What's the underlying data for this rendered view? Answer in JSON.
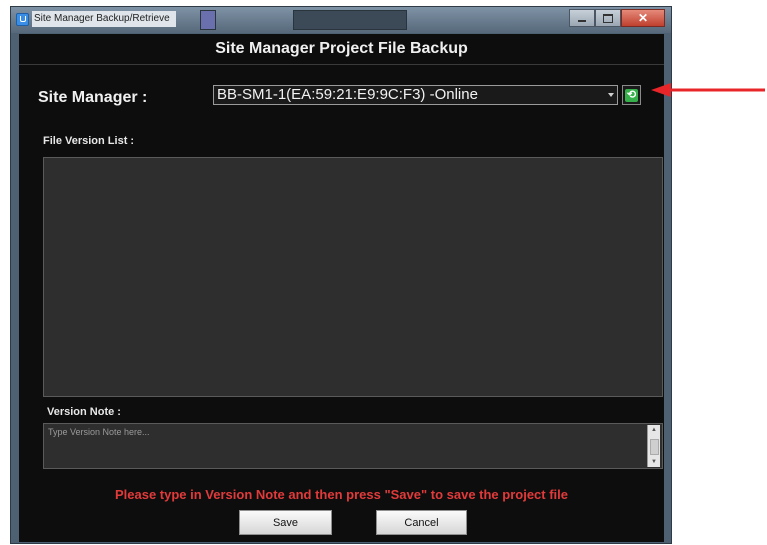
{
  "window": {
    "title": "Site Manager Backup/Retrieve"
  },
  "header": {
    "title": "Site Manager Project File Backup"
  },
  "site_manager": {
    "label": "Site Manager :",
    "selected": "BB-SM1-1(EA:59:21:E9:9C:F3) -Online"
  },
  "file_version_list": {
    "label": "File Version List :"
  },
  "version_note": {
    "label": "Version Note :",
    "placeholder": "Type Version Note here...",
    "value": ""
  },
  "message": "Please type in Version Note and then press \"Save\" to save the project file",
  "buttons": {
    "save": "Save",
    "cancel": "Cancel"
  },
  "colors": {
    "panel_background": "#0d0d0d",
    "message_red": "#e23a3a",
    "refresh_green": "#35b04a",
    "annotation_arrow": "#e8262a"
  },
  "icons": {
    "app": "app-icon",
    "refresh": "refresh-icon",
    "minimize": "minimize-icon",
    "maximize": "maximize-icon",
    "close": "close-icon"
  }
}
